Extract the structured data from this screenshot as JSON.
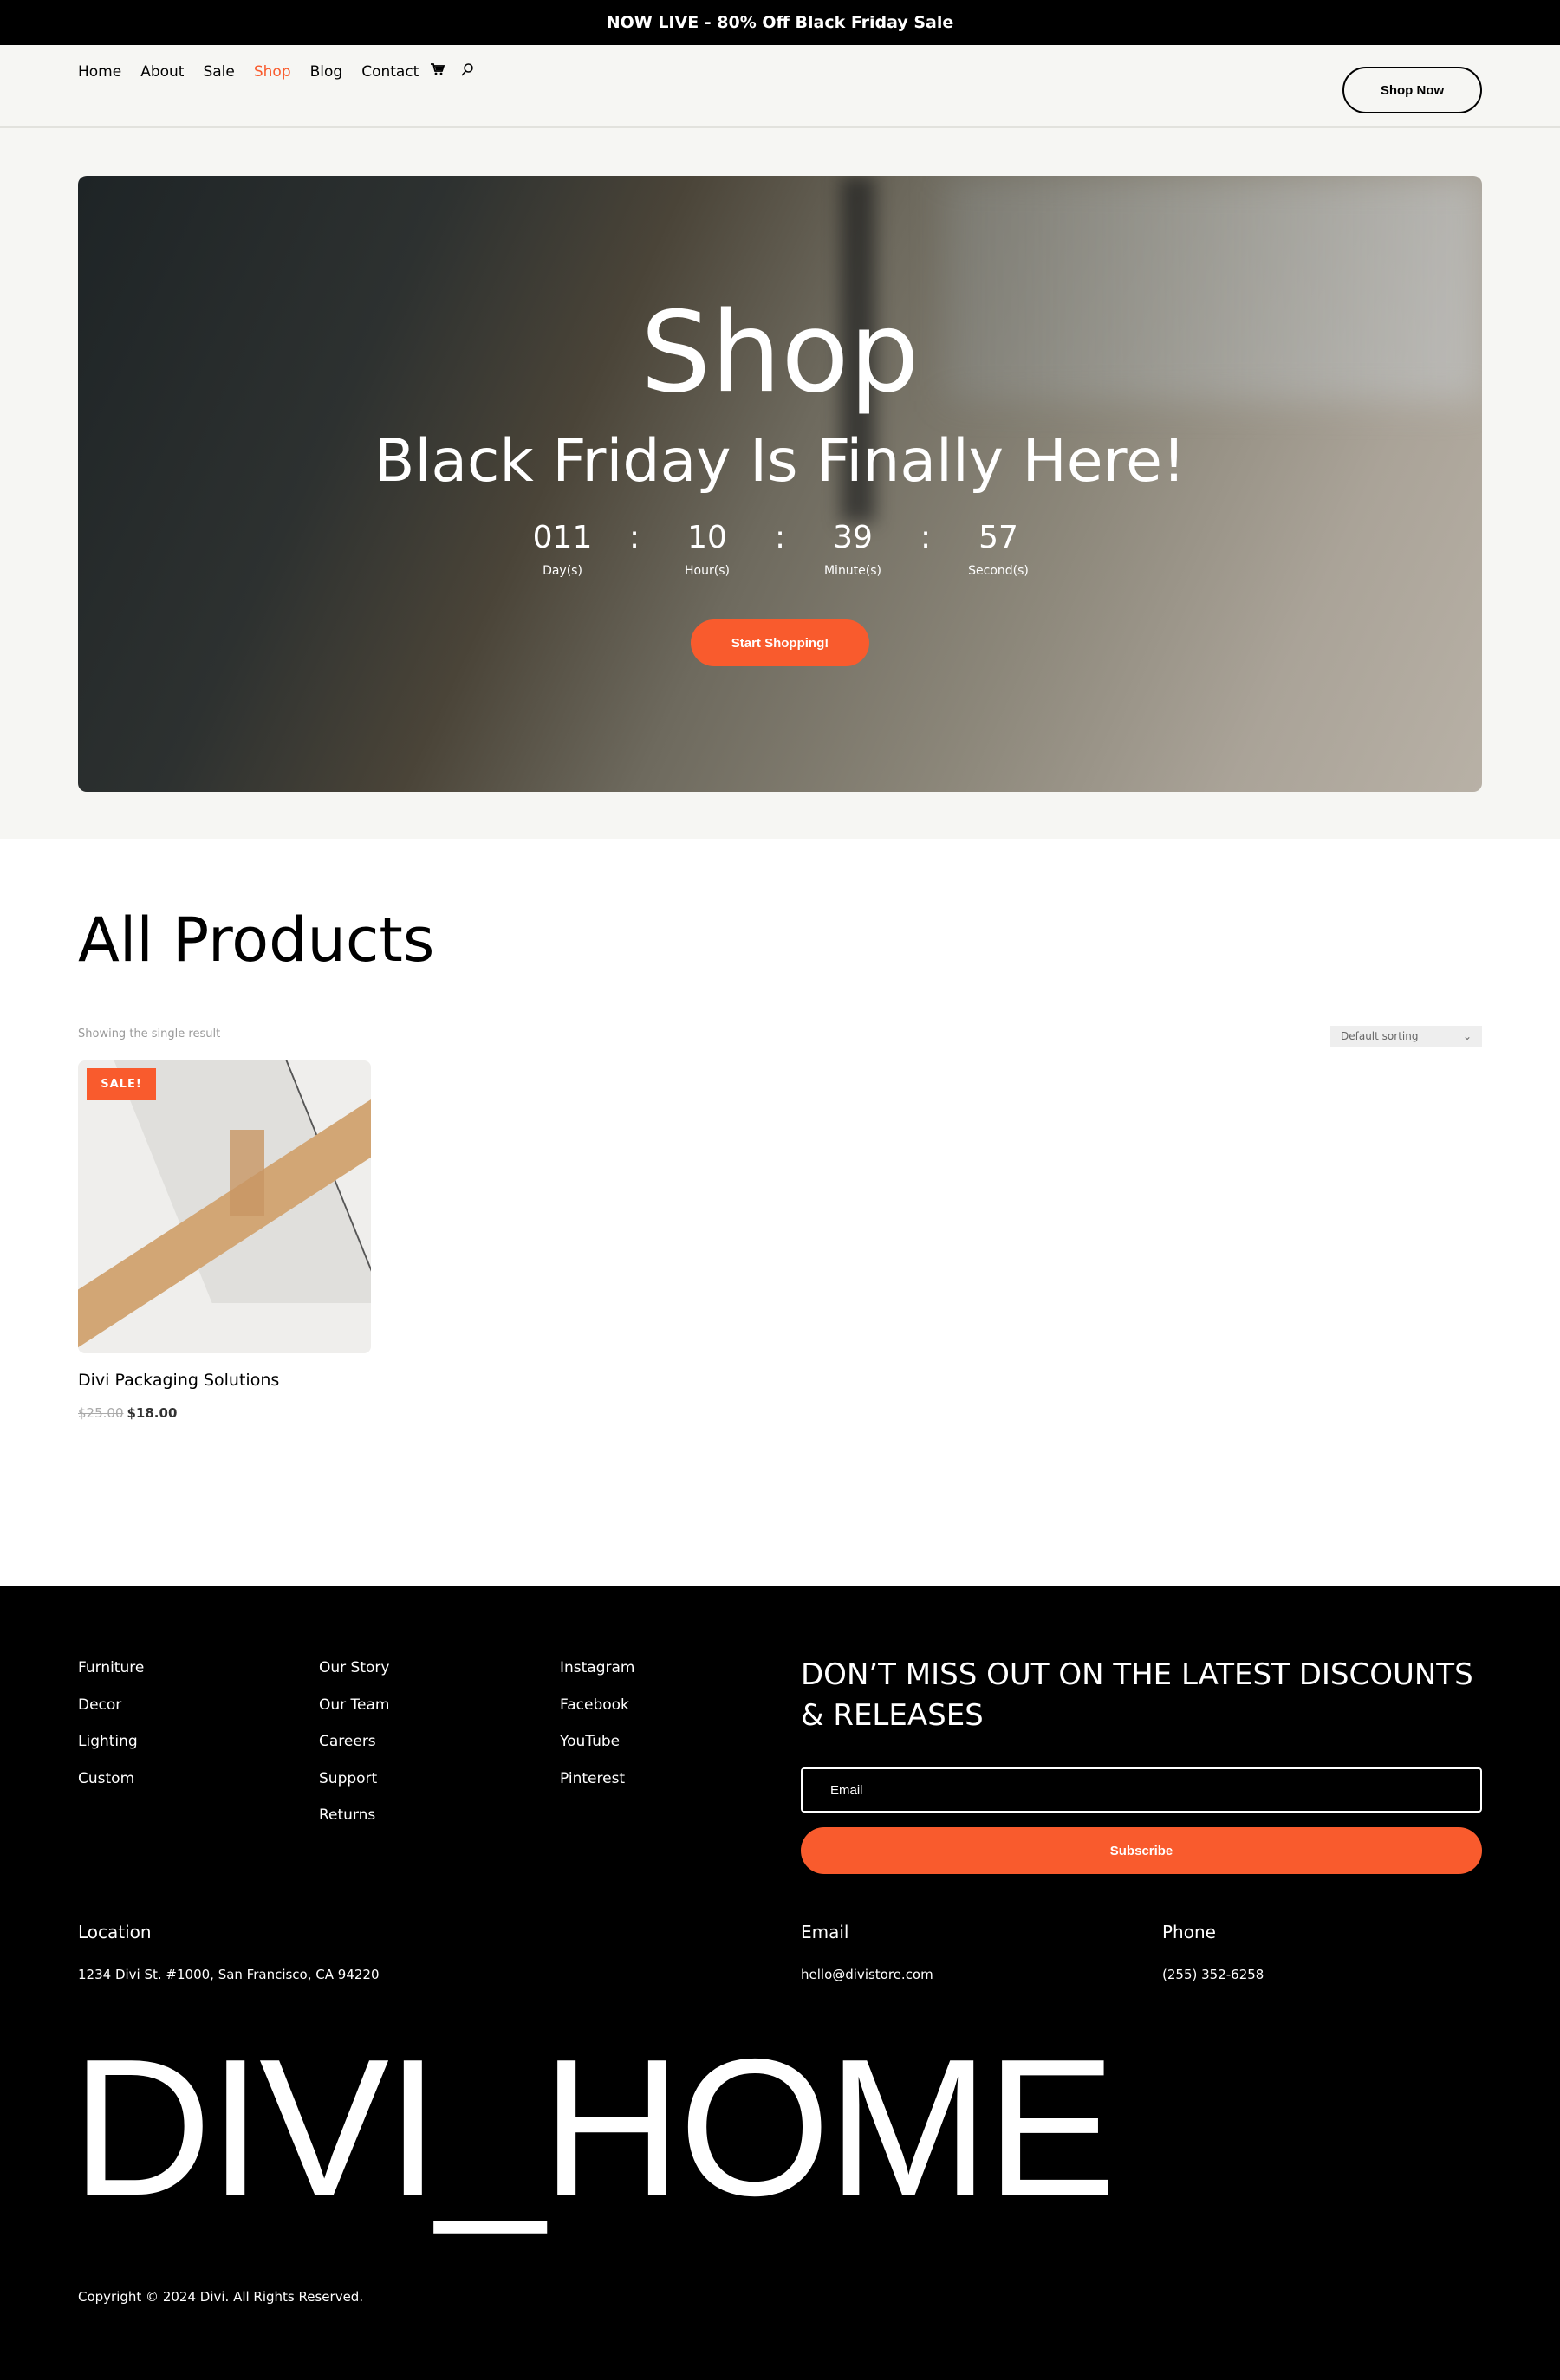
{
  "announcement": "NOW LIVE - 80% Off Black Friday Sale",
  "nav": {
    "items": [
      "Home",
      "About",
      "Sale",
      "Shop",
      "Blog",
      "Contact"
    ],
    "active": "Shop",
    "cart_icon": "cart-icon",
    "search_icon": "search-icon",
    "cta": "Shop Now"
  },
  "hero": {
    "title": "Shop",
    "subtitle": "Black Friday Is Finally Here!",
    "countdown": [
      {
        "value": "011",
        "label": "Day(s)"
      },
      {
        "value": "10",
        "label": "Hour(s)"
      },
      {
        "value": "39",
        "label": "Minute(s)"
      },
      {
        "value": "57",
        "label": "Second(s)"
      }
    ],
    "separator": ":",
    "button": "Start Shopping!"
  },
  "products": {
    "heading": "All Products",
    "result_count": "Showing the single result",
    "sorting": "Default sorting",
    "items": [
      {
        "badge": "SALE!",
        "title": "Divi Packaging Solutions",
        "old_price": "$25.00",
        "price": "$18.00"
      }
    ]
  },
  "footer": {
    "col1": [
      "Furniture",
      "Decor",
      "Lighting",
      "Custom"
    ],
    "col2": [
      "Our Story",
      "Our Team",
      "Careers",
      "Support",
      "Returns"
    ],
    "col3": [
      "Instagram",
      "Facebook",
      "YouTube",
      "Pinterest"
    ],
    "newsletter": {
      "heading": "DON’T MISS OUT ON THE LATEST DISCOUNTS & RELEASES",
      "email_placeholder": "Email",
      "button": "Subscribe"
    },
    "contact": {
      "location_label": "Location",
      "location": "1234 Divi St. #1000, San Francisco, CA 94220",
      "email_label": "Email",
      "email": "hello@divistore.com",
      "phone_label": "Phone",
      "phone": "(255) 352-6258"
    },
    "brand": "DIVI_HOME",
    "copyright": "Copyright © 2024 Divi. All Rights Reserved."
  },
  "colors": {
    "accent": "#f95b2d",
    "nav_bg": "#f6f6f3",
    "footer_bg": "#000000"
  }
}
